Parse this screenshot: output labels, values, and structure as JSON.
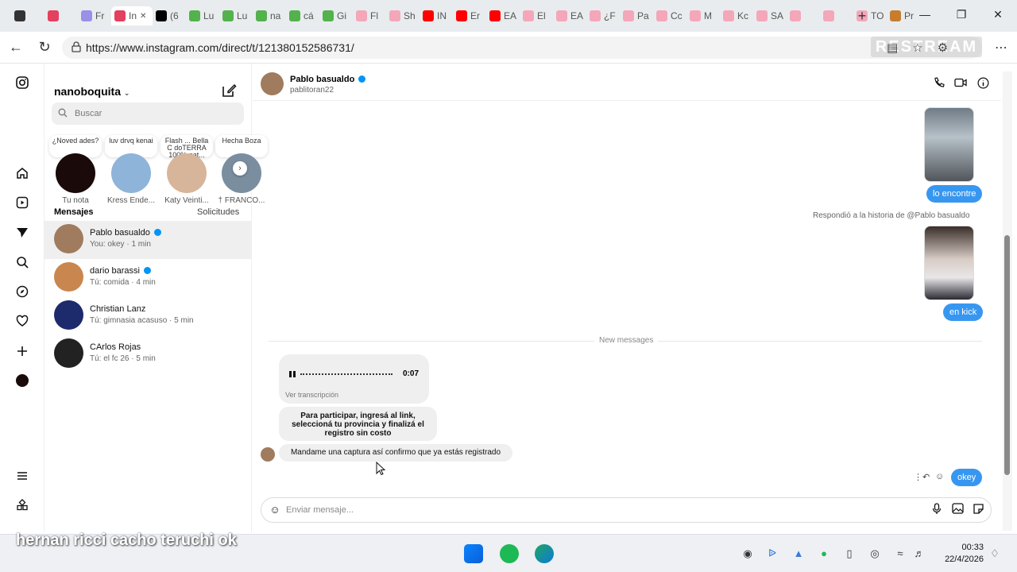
{
  "browser": {
    "tabs": [
      {
        "label": "",
        "color": "#333333"
      },
      {
        "label": "",
        "color": "#e4405f"
      },
      {
        "label": "Fr",
        "color": "#9b8fe8"
      },
      {
        "label": "In",
        "color": "#e4405f",
        "active": true
      },
      {
        "label": "(6",
        "color": "#000000"
      },
      {
        "label": "Lu",
        "color": "#53b24c"
      },
      {
        "label": "Lu",
        "color": "#53b24c"
      },
      {
        "label": "na",
        "color": "#53b24c"
      },
      {
        "label": "cá",
        "color": "#53b24c"
      },
      {
        "label": "Gi",
        "color": "#53b24c"
      },
      {
        "label": "Fl",
        "color": "#f4a7b9"
      },
      {
        "label": "Sh",
        "color": "#f4a7b9"
      },
      {
        "label": "IN",
        "color": "#ff0000"
      },
      {
        "label": "Er",
        "color": "#ff0000"
      },
      {
        "label": "EA",
        "color": "#ff0000"
      },
      {
        "label": "El",
        "color": "#f4a7b9"
      },
      {
        "label": "EA",
        "color": "#f4a7b9"
      },
      {
        "label": "¿F",
        "color": "#f4a7b9"
      },
      {
        "label": "Pa",
        "color": "#f4a7b9"
      },
      {
        "label": "Cc",
        "color": "#f4a7b9"
      },
      {
        "label": "M",
        "color": "#f4a7b9"
      },
      {
        "label": "Kc",
        "color": "#f4a7b9"
      },
      {
        "label": "SA",
        "color": "#f4a7b9"
      },
      {
        "label": "",
        "color": "#f4a7b9"
      },
      {
        "label": "",
        "color": "#f4a7b9"
      },
      {
        "label": "TO",
        "color": "#f4a7b9"
      },
      {
        "label": "Pr",
        "color": "#c77d2e"
      }
    ],
    "url": "https://www.instagram.com/direct/t/121380152586731/",
    "watermark": "RESTREAM"
  },
  "sidebar": {
    "username": "nanoboquita",
    "search_placeholder": "Buscar",
    "stories": [
      {
        "note": "¿Noved ades?",
        "name": "Tu nota",
        "color": "#1a0a0a"
      },
      {
        "note": "luv drvq kenai",
        "name": "Kress Ende...",
        "color": "#8fb4d9"
      },
      {
        "note": "Flash ... Bella C doTERRA 100% nat...",
        "name": "Katy Veinti...",
        "color": "#d7b59a"
      },
      {
        "note": "Hecha Boza",
        "name": "† FRANCO...",
        "color": "#7a8ea0"
      }
    ],
    "messages_header": "Mensajes",
    "requests_label": "Solicitudes",
    "conversations": [
      {
        "name": "Pablo basualdo",
        "preview": "You: okey · 1 min",
        "verified": true,
        "color": "#a07b5e"
      },
      {
        "name": "dario barassi",
        "preview": "Tú: comida · 4 min",
        "verified": true,
        "color": "#c9864f"
      },
      {
        "name": "Christian Lanz",
        "preview": "Tú: gimnasia acasuso · 5 min",
        "verified": false,
        "color": "#1d2a6b"
      },
      {
        "name": "CArlos Rojas",
        "preview": "Tú: el fc 26 · 5 min",
        "verified": false,
        "color": "#222222"
      }
    ]
  },
  "chat": {
    "name": "Pablo basualdo",
    "handle": "pablitoran22",
    "reply1": "lo encontre",
    "reply_note": "Respondió a la historia de @Pablo basualdo",
    "reply2": "en kick",
    "new_messages": "New messages",
    "audio_duration": "0:07",
    "transcription_link": "Ver transcripción",
    "msg1": "Para participar, ingresá al link, seleccioná tu provincia y finalizá el registro sin costo",
    "msg2": "Mandame una captura así confirmo que ya estás registrado",
    "my_reply": "okey",
    "composer_placeholder": "Enviar mensaje..."
  },
  "overlay_caption": "hernan ricci cacho teruchi ok",
  "taskbar": {
    "time": "00:33",
    "date": "22/4/2026"
  },
  "colors": {
    "accent": "#3797f0",
    "verified": "#0095f6"
  }
}
